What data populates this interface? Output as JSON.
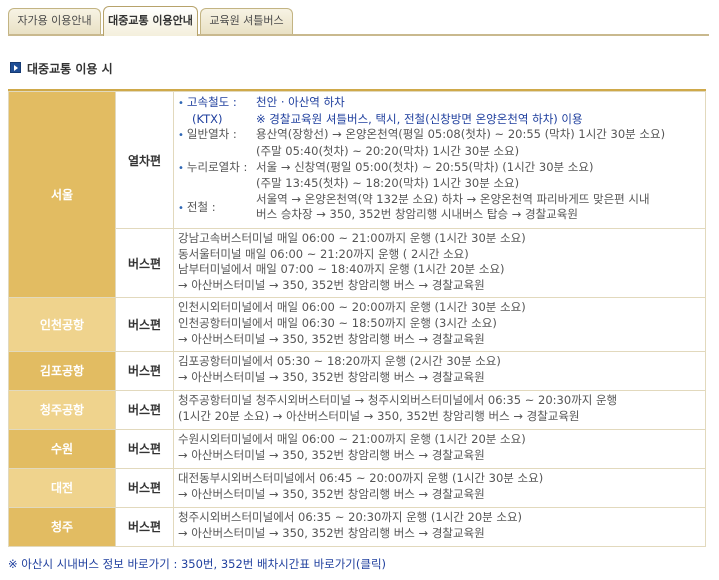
{
  "tabs": [
    {
      "label": "자가용 이용안내",
      "active": false
    },
    {
      "label": "대중교통 이용안내",
      "active": true
    },
    {
      "label": "교육원 셔틀버스",
      "active": false
    }
  ],
  "section_title": "대중교통 이용 시",
  "regions": {
    "seoul": {
      "name": "서울",
      "train": {
        "mode": "열차편",
        "ktx": {
          "label1": "고속철도 :",
          "label2": "(KTX)",
          "line1": "천안 · 아산역 하차",
          "line2": "※ 경찰교육원 셔틀버스, 택시, 전철(신창방면 온양온천역 하차) 이용"
        },
        "general": {
          "label": "일반열차 :",
          "line1": "용산역(장항선) → 온양온천역(평일 05:08(첫차) ~ 20:55 (막차) 1시간 30분 소요)",
          "line2": "(주말 05:40(첫차) ~ 20:20(막차) 1시간 30분 소요)"
        },
        "nuri": {
          "label": "누리로열차 :",
          "line1": "서울 → 신창역(평일 05:00(첫차) ~ 20:55(막차) (1시간 30분 소요)",
          "line2": "(주말 13:45(첫차) ~ 18:20(막차) 1시간 30분 소요)"
        },
        "subway": {
          "label": "전철 :",
          "line1": "서울역 → 온양온천역(약 132분 소요) 하차 → 온양온천역 파리바게뜨 맞은편 시내",
          "line2": "버스 승차장 → 350, 352번 창암리행 시내버스 탑승 → 경찰교육원"
        }
      },
      "bus": {
        "mode": "버스편",
        "lines": [
          "강남고속버스터미널 매일 06:00 ~ 21:00까지 운행 (1시간 30분 소요)",
          "동서울터미널 매일 06:00 ~ 21:20까지 운행 ( 2시간 소요)",
          "남부터미널에서 매일 07:00 ~ 18:40까지 운행 (1시간 20분 소요)",
          "→ 아산버스터미널 → 350, 352번 창암리행 버스 → 경찰교육원"
        ]
      }
    },
    "incheon_airport": {
      "name": "인천공항",
      "mode": "버스편",
      "lines": [
        "인천시외터미널에서 매일 06:00 ~ 20:00까지 운행 (1시간 30분 소요)",
        "인천공항터미널에서 매일 06:30 ~ 18:50까지 운행 (3시간 소요)",
        "→ 아산버스터미널 → 350, 352번 창암리행 버스 → 경찰교육원"
      ]
    },
    "gimpo_airport": {
      "name": "김포공항",
      "mode": "버스편",
      "lines": [
        "김포공항터미널에서 05:30 ~ 18:20까지 운행 (2시간 30분 소요)",
        "→ 아산버스터미널 → 350, 352번 창암리행 버스 → 경찰교육원"
      ]
    },
    "cheongju_airport": {
      "name": "청주공항",
      "mode": "버스편",
      "lines": [
        "청주공항터미널 청주시외버스터미널 → 청주시외버스터미널에서 06:35 ~ 20:30까지 운행",
        "(1시간 20분 소요) → 아산버스터미널 → 350, 352번 창암리행 버스 → 경찰교육원"
      ]
    },
    "suwon": {
      "name": "수원",
      "mode": "버스편",
      "lines": [
        "수원시외터미널에서 매일 06:00 ~ 21:00까지 운행 (1시간 20분 소요)",
        "→ 아산버스터미널 → 350, 352번 창암리행 버스 → 경찰교육원"
      ]
    },
    "daejeon": {
      "name": "대전",
      "mode": "버스편",
      "lines": [
        "대전동부시외버스터미널에서 06:45 ~ 20:00까지 운행 (1시간 30분 소요)",
        "→ 아산버스터미널 → 350, 352번 창암리행 버스 → 경찰교육원"
      ]
    },
    "cheongju": {
      "name": "청주",
      "mode": "버스편",
      "lines": [
        "청주시외버스터미널에서 06:35 ~ 20:30까지 운행 (1시간 20분 소요)",
        "→ 아산버스터미널 → 350, 352번 창암리행 버스 → 경찰교육원"
      ]
    }
  },
  "footnote": "※ 아산시 시내버스 정보 바로가기 : 350번, 352번 배차시간표 바로가기(클릭)"
}
